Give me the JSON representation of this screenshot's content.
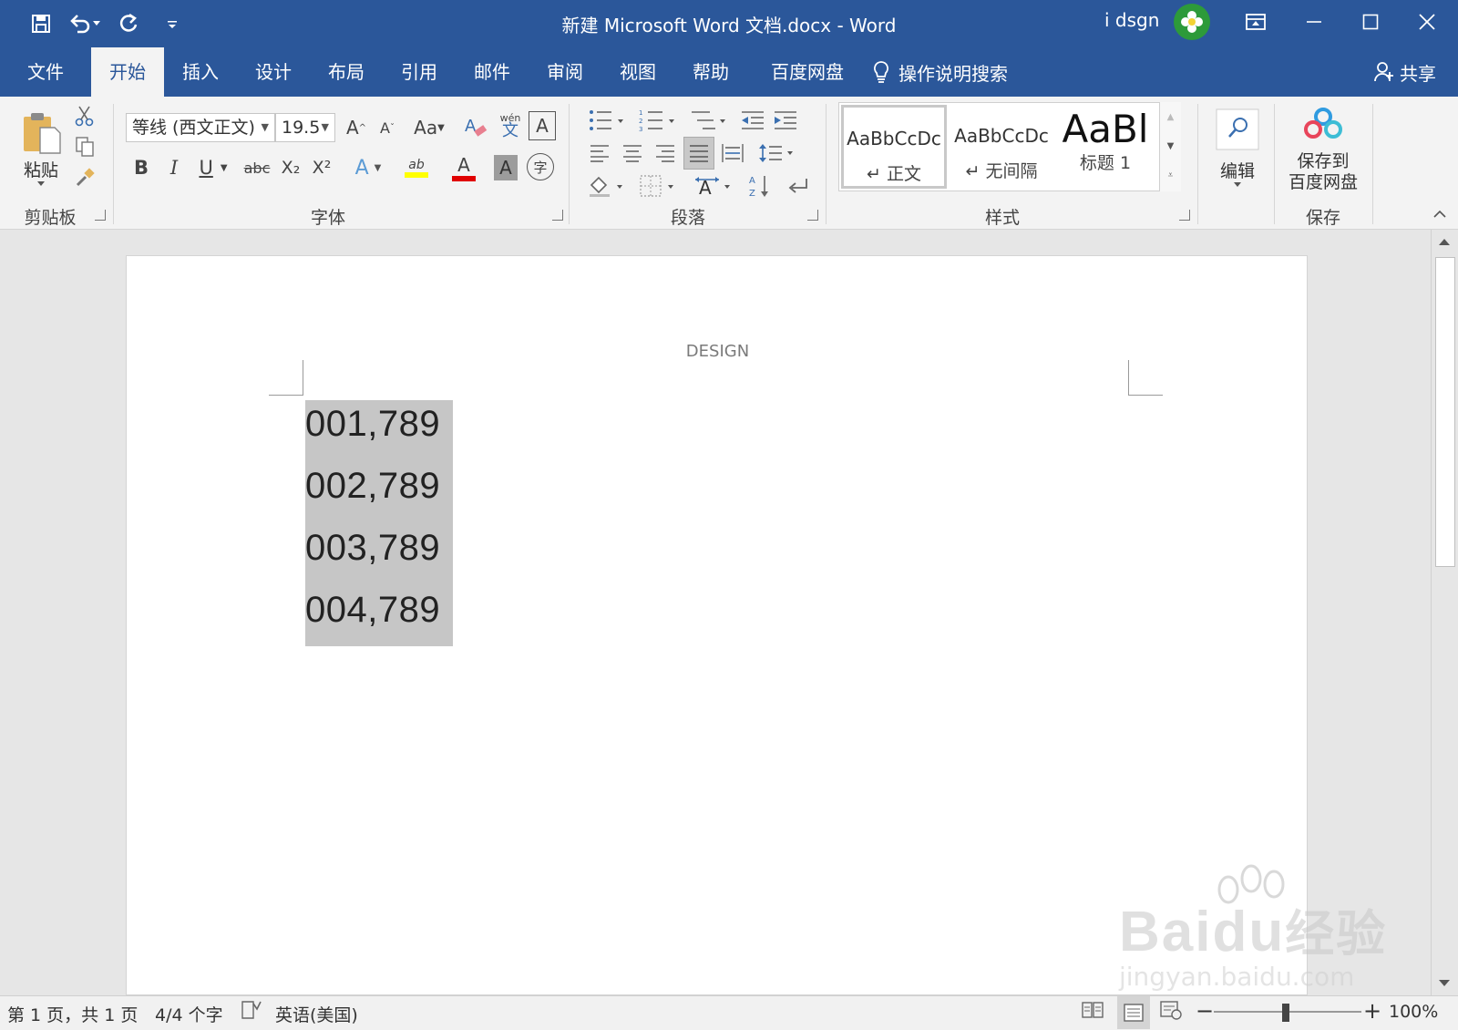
{
  "window": {
    "title": "新建 Microsoft Word 文档.docx  -  Word",
    "user_name": "i dsgn"
  },
  "tabs": [
    "文件",
    "开始",
    "插入",
    "设计",
    "布局",
    "引用",
    "邮件",
    "审阅",
    "视图",
    "帮助",
    "百度网盘"
  ],
  "active_tab": "开始",
  "tell_me": "操作说明搜索",
  "share": "共享",
  "ribbon": {
    "clipboard": {
      "paste": "粘贴",
      "group": "剪贴板"
    },
    "font": {
      "name": "等线 (西文正文)",
      "size": "19.5",
      "group": "字体",
      "grow_label": "A",
      "shrink_label": "A",
      "case_label": "Aa",
      "phonetic_label": "wén",
      "phonetic_label_2": "文",
      "border_char_label": "A",
      "bold_label": "B",
      "italic_label": "I",
      "underline_label": "U",
      "strike_label": "abc",
      "subscript_label": "X₂",
      "superscript_label": "X²",
      "effect_label": "A",
      "highlight_label": "ab",
      "font_color_label": "A",
      "shading_label": "A",
      "enclose_label": "字"
    },
    "paragraph": {
      "group": "段落"
    },
    "styles": {
      "group": "样式",
      "items": [
        {
          "sample": "AaBbCcDc",
          "name": "↵ 正文"
        },
        {
          "sample": "AaBbCcDc",
          "name": "↵ 无间隔"
        },
        {
          "sample": "AaBl",
          "name": "标题 1"
        }
      ]
    },
    "editing": {
      "label": "编辑"
    },
    "save": {
      "line1": "保存到",
      "line2": "百度网盘",
      "group": "保存"
    }
  },
  "document": {
    "header": "DESIGN",
    "lines": [
      "001,789",
      "002,789",
      "003,789",
      "004,789"
    ]
  },
  "status": {
    "page": "第 1 页，共 1 页",
    "words": "4/4 个字",
    "language": "英语(美国)",
    "zoom": "100%",
    "zoom_minus": "−",
    "zoom_plus": "+"
  },
  "watermark": {
    "brand": "Bai",
    "brand_2": "du",
    "brand_3": "经验",
    "url": "jingyan.baidu.com"
  },
  "colors": {
    "accent": "#2b579a",
    "selection": "#c6c6c6",
    "ribbon_bg": "#f3f3f3"
  }
}
